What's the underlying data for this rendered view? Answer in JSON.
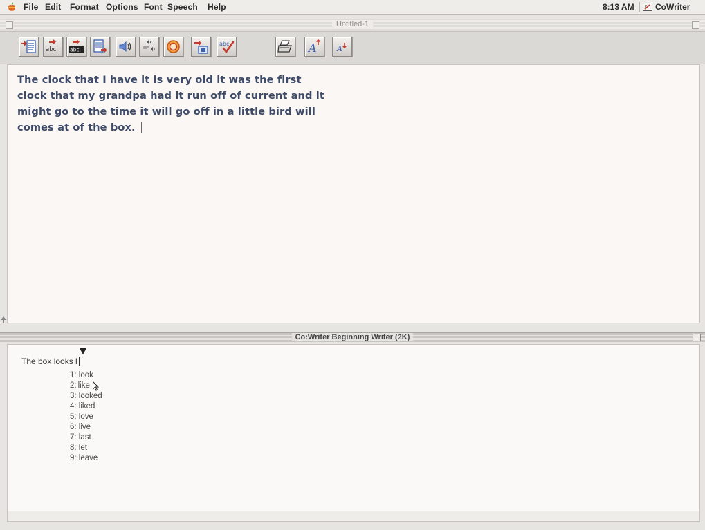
{
  "menubar": {
    "items": [
      "File",
      "Edit",
      "Format",
      "Options",
      "Font",
      "Speech",
      "Help"
    ],
    "clock": "8:13 AM",
    "app_name": "CoWriter"
  },
  "document": {
    "title": "Untitled-1",
    "toolbar": [
      {
        "icon": "document-list-icon"
      },
      {
        "icon": "abc-arrow-icon",
        "text": "abc."
      },
      {
        "icon": "abc-arrow-dark-icon",
        "text": "abc."
      },
      {
        "icon": "document-arrow-icon"
      },
      {
        "icon": "speaker-icon"
      },
      {
        "icon": "repeat-speech-icon"
      },
      {
        "icon": "record-icon"
      },
      {
        "icon": "window-transfer-icon"
      },
      {
        "icon": "spell-check-icon",
        "text": "abc"
      },
      {
        "icon": "printer-icon"
      },
      {
        "icon": "font-larger-icon",
        "text": "A"
      },
      {
        "icon": "font-smaller-icon",
        "text": "A"
      }
    ],
    "lines": [
      "The clock that I have it is very old it was the first",
      "clock that my grandpa had it run off of current and it",
      "might go to the time it will go off in a little bird will",
      "comes at of the box."
    ]
  },
  "cowriter": {
    "title": "Co:Writer Beginning Writer (2K)",
    "input_text": "The box looks l",
    "predictions": [
      {
        "number": "1:",
        "word": "look"
      },
      {
        "number": "2:",
        "word": "like",
        "selected": true
      },
      {
        "number": "3:",
        "word": "looked"
      },
      {
        "number": "4:",
        "word": "liked"
      },
      {
        "number": "5:",
        "word": "love"
      },
      {
        "number": "6:",
        "word": "live"
      },
      {
        "number": "7:",
        "word": "last"
      },
      {
        "number": "8:",
        "word": "let"
      },
      {
        "number": "9:",
        "word": "leave"
      }
    ]
  },
  "colors": {
    "doc_text": "#3d4a68",
    "doc_background": "#fbf7f4",
    "toolbar_red": "#c43a2f",
    "toolbar_blue": "#3a5fb0"
  }
}
